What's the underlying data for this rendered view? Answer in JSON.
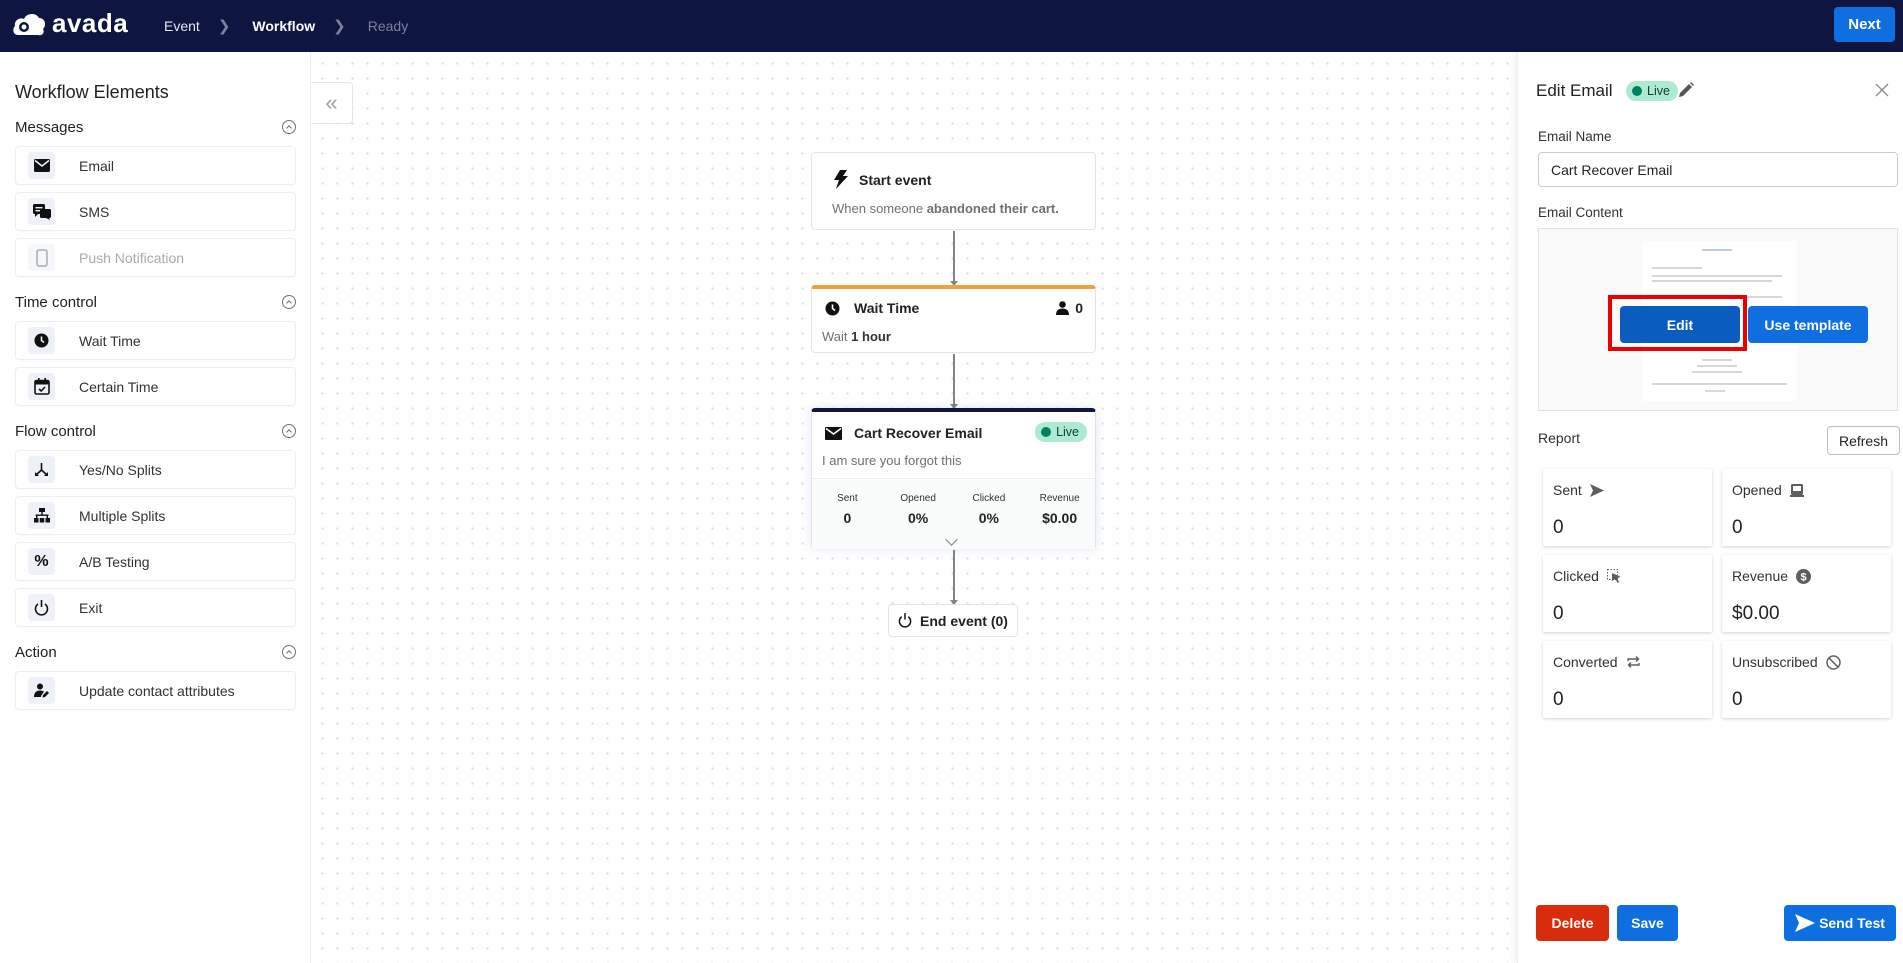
{
  "app": {
    "brand": "avada",
    "breadcrumbs": [
      {
        "label": "Event",
        "state": "done"
      },
      {
        "label": "Workflow",
        "state": "active"
      },
      {
        "label": "Ready",
        "state": "disabled"
      }
    ],
    "next_label": "Next",
    "colors": {
      "topbar": "#0d1540",
      "primary": "#0f6fe0",
      "danger": "#d82c0d",
      "wait_accent": "#f2a03d",
      "live_badge": "#aee9d1",
      "highlight": "#ee0000"
    }
  },
  "sidebar": {
    "title": "Workflow Elements",
    "sections": [
      {
        "title": "Messages",
        "items": [
          {
            "label": "Email",
            "icon": "envelope-icon",
            "disabled": false
          },
          {
            "label": "SMS",
            "icon": "chat-icon",
            "disabled": false
          },
          {
            "label": "Push Notification",
            "icon": "mobile-icon",
            "disabled": true
          }
        ]
      },
      {
        "title": "Time control",
        "items": [
          {
            "label": "Wait Time",
            "icon": "clock-icon",
            "disabled": false
          },
          {
            "label": "Certain Time",
            "icon": "calendar-check-icon",
            "disabled": false
          }
        ]
      },
      {
        "title": "Flow control",
        "items": [
          {
            "label": "Yes/No Splits",
            "icon": "split-icon",
            "disabled": false
          },
          {
            "label": "Multiple Splits",
            "icon": "hierarchy-icon",
            "disabled": false
          },
          {
            "label": "A/B Testing",
            "icon": "percent-icon",
            "disabled": false
          },
          {
            "label": "Exit",
            "icon": "power-icon",
            "disabled": false
          }
        ]
      },
      {
        "title": "Action",
        "items": [
          {
            "label": "Update contact attributes",
            "icon": "user-edit-icon",
            "disabled": false
          }
        ]
      }
    ]
  },
  "canvas": {
    "start": {
      "title": "Start event",
      "desc_prefix": "When someone",
      "desc_bold": "abandoned their cart."
    },
    "wait": {
      "title": "Wait Time",
      "count": "0",
      "desc_prefix": "Wait",
      "desc_bold": "1 hour"
    },
    "email": {
      "title": "Cart Recover Email",
      "status": "Live",
      "subject": "I am sure you forgot this",
      "stats": [
        {
          "label": "Sent",
          "value": "0"
        },
        {
          "label": "Opened",
          "value": "0%"
        },
        {
          "label": "Clicked",
          "value": "0%"
        },
        {
          "label": "Revenue",
          "value": "$0.00"
        }
      ]
    },
    "end": {
      "label": "End event (0)"
    }
  },
  "panel": {
    "title": "Edit Email",
    "status": "Live",
    "email_name_label": "Email Name",
    "email_name_value": "Cart Recover Email",
    "email_content_label": "Email Content",
    "edit_label": "Edit",
    "use_template_label": "Use template",
    "report_label": "Report",
    "refresh_label": "Refresh",
    "report": [
      {
        "label": "Sent",
        "icon": "send-icon",
        "value": "0"
      },
      {
        "label": "Opened",
        "icon": "inbox-icon",
        "value": "0"
      },
      {
        "label": "Clicked",
        "icon": "cursor-select-icon",
        "value": "0"
      },
      {
        "label": "Revenue",
        "icon": "dollar-circle-icon",
        "value": "$0.00"
      },
      {
        "label": "Converted",
        "icon": "repeat-icon",
        "value": "0"
      },
      {
        "label": "Unsubscribed",
        "icon": "ban-icon",
        "value": "0"
      }
    ],
    "delete_label": "Delete",
    "save_label": "Save",
    "send_test_label": "Send Test"
  }
}
